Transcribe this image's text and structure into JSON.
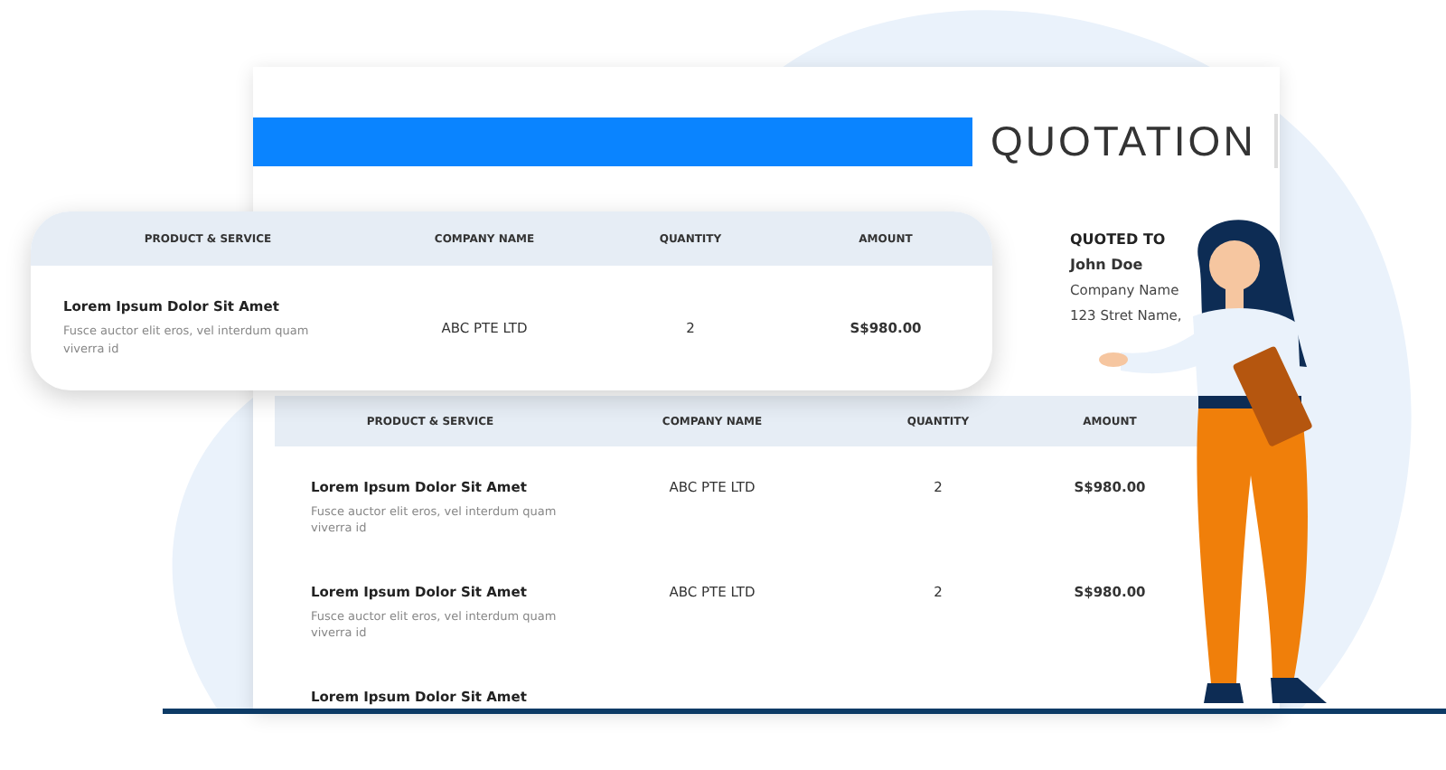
{
  "document": {
    "title": "QUOTATION",
    "quoted_to": {
      "label": "QUOTED TO",
      "name": "John Doe",
      "company": "Company Name",
      "address": "123 Stret Name,"
    },
    "table": {
      "columns": [
        "PRODUCT & SERVICE",
        "COMPANY NAME",
        "QUANTITY",
        "AMOUNT"
      ],
      "rows": [
        {
          "product": "Lorem Ipsum Dolor Sit Amet",
          "description": "Fusce auctor elit eros, vel interdum quam viverra id",
          "company": "ABC PTE LTD",
          "quantity": "2",
          "amount": "S$980.00"
        },
        {
          "product": "Lorem Ipsum Dolor Sit Amet",
          "description": "Fusce auctor elit eros, vel interdum quam viverra id",
          "company": "ABC PTE LTD",
          "quantity": "2",
          "amount": "S$980.00"
        },
        {
          "product": "Lorem Ipsum Dolor Sit Amet"
        }
      ]
    }
  },
  "floating_card": {
    "columns": [
      "PRODUCT & SERVICE",
      "COMPANY NAME",
      "QUANTITY",
      "AMOUNT"
    ],
    "rows": [
      {
        "product": "Lorem Ipsum Dolor Sit Amet",
        "description": "Fusce auctor elit eros, vel interdum quam viverra id",
        "company": "ABC PTE LTD",
        "quantity": "2",
        "amount": "S$980.00"
      }
    ]
  }
}
